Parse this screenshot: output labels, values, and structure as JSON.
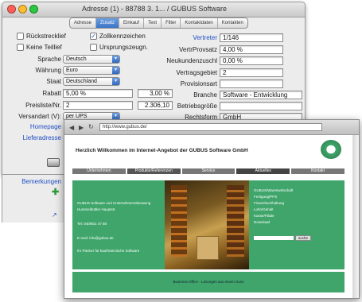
{
  "window": {
    "title": "Adresse (1) - 88788 3. 1... / GUBUS Software"
  },
  "tabs": [
    "Adresse",
    "Zusatz",
    "Einkauf",
    "Text",
    "Filter",
    "Kontaktdaten",
    "Kontakten"
  ],
  "checkboxes": {
    "rueckscheck": "Rückstrecklief",
    "zollkenn": "Zollkennzeichen",
    "keine_teil": "Keine Teillief",
    "ursprung": "Ursprungszeugn."
  },
  "labels": {
    "sprache": "Sprache",
    "waehrung": "Währung",
    "staat": "Staat",
    "rabatt": "Rabatt",
    "preisliste": "Preisliste/Nr.",
    "versandart": "Versandart (V):",
    "homepage": "Homepage",
    "lieferadresse": "Lieferadresse",
    "bemerkungen": "Bemerkungen",
    "vertreter": "Vertreter",
    "vertrprov": "VertrProvsatz",
    "neukunde": "Neukundenzuschl",
    "vertragsgebiet": "Vertragsgebiet",
    "provisionsart": "Provisionsart",
    "branche": "Branche",
    "betriebsgroesse": "Betriebsgröße",
    "rechtsform": "Rechtsform"
  },
  "values": {
    "sprache": "Deutsch",
    "waehrung": "Euro",
    "staat": "Deutschland",
    "rabatt": "5,00 %",
    "rabatt2": "3,00 %",
    "preisliste": "2",
    "preis2": "2.306,10",
    "versandart": "per UPS",
    "vertreter": "1/146",
    "vertrprov": "4,00 %",
    "neukunde": "0,00 %",
    "vertragsgebiet": "2",
    "branche": "Software - Entwicklung",
    "rechtsform": "GmbH"
  },
  "browser": {
    "url": "http://www.gubus.de/",
    "welcome": "Herzlich Willkommen im Internet-Angebot der GUBUS Software GmbH",
    "nav": [
      "Unternehmen",
      "Produkte/Referenzen",
      "Service",
      "Aktuelles",
      "Kontakt"
    ],
    "left_text": [
      "GUBUS Software und Unternehmensberatung",
      "Hummelbüttler Hauptstr.",
      "Tel: 040/601 47 88",
      "E-mail: info@gubus.de",
      "Ihr Partner für kaufmännische Software"
    ],
    "right_links": [
      "GUBUS/Warenwirtschaft",
      "Fertigung/PPS",
      "Finanzbuchhaltung",
      "Lohn/Gehalt",
      "Kasse/Filiale",
      "Download"
    ],
    "search_btn": "suche",
    "footer": "Business-Office - Lösungen aus einem Guss"
  },
  "colors": {
    "brand_green": "#3fa56a",
    "link_blue": "#1f4fc4"
  }
}
